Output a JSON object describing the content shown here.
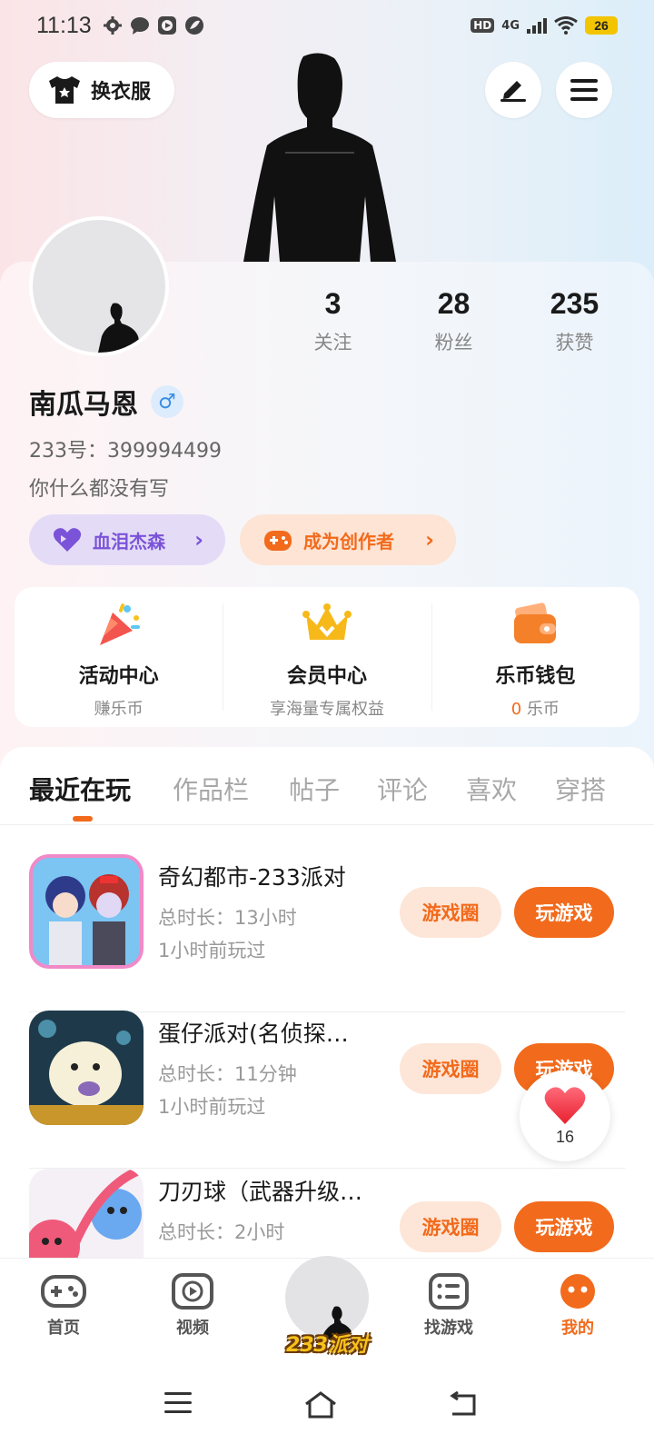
{
  "status_bar": {
    "time": "11:13",
    "hd": "HD",
    "network": "4G",
    "battery": "26"
  },
  "header": {
    "wardrobe_label": "换衣服",
    "wardrobe_icon": "tshirt-icon",
    "edit_icon": "pen-icon",
    "menu_icon": "menu-icon"
  },
  "profile": {
    "username": "南瓜马恩",
    "gender_symbol": "♂",
    "uid": "233号：399994499",
    "bio": "你什么都没有写",
    "stats": [
      {
        "value": "3",
        "label": "关注"
      },
      {
        "value": "28",
        "label": "粉丝"
      },
      {
        "value": "235",
        "label": "获赞"
      }
    ],
    "chips": {
      "fan_label": "血泪杰森",
      "creator_label": "成为创作者"
    }
  },
  "features": [
    {
      "title": "活动中心",
      "subtitle": "赚乐币",
      "icon": "party-popper-icon"
    },
    {
      "title": "会员中心",
      "subtitle": "享海量专属权益",
      "icon": "crown-icon"
    },
    {
      "title": "乐币钱包",
      "coin": "0",
      "subtitle": "乐币",
      "icon": "wallet-icon"
    }
  ],
  "tabs": [
    "最近在玩",
    "作品栏",
    "帖子",
    "评论",
    "喜欢",
    "穿搭"
  ],
  "games": [
    {
      "title": "奇幻都市-233派对",
      "duration": "总时长：13小时",
      "played": "1小时前玩过",
      "circle_label": "游戏圈",
      "play_label": "玩游戏"
    },
    {
      "title": "蛋仔派对(名侦探…",
      "duration": "总时长：11分钟",
      "played": "1小时前玩过",
      "circle_label": "游戏圈",
      "play_label": "玩游戏"
    },
    {
      "title": "刀刃球（武器升级…",
      "duration": "总时长：2小时",
      "played": "",
      "circle_label": "游戏圈",
      "play_label": "玩游戏"
    }
  ],
  "like_float": {
    "count": "16",
    "icon": "heart-icon"
  },
  "bottom_nav": [
    {
      "label": "首页",
      "icon": "gamepad-icon"
    },
    {
      "label": "视频",
      "icon": "video-play-icon"
    },
    {
      "label": "233派对",
      "icon": "party-logo"
    },
    {
      "label": "找游戏",
      "icon": "list-icon"
    },
    {
      "label": "我的",
      "icon": "face-icon"
    }
  ],
  "colors": {
    "accent": "#f26a1b",
    "fan_chip": "#7b53d8",
    "male": "#3a8ee6"
  }
}
